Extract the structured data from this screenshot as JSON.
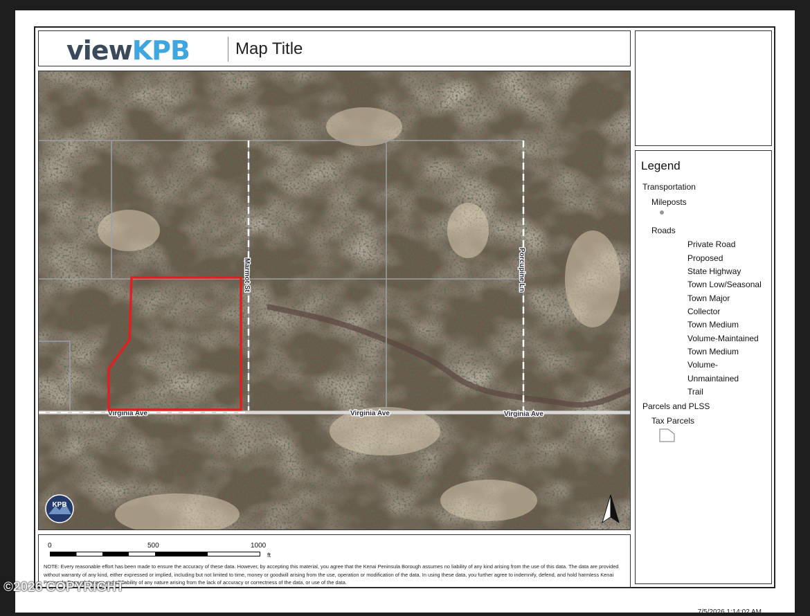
{
  "header": {
    "logo_part1": "view",
    "logo_part2": "KPB",
    "map_title": "Map Title"
  },
  "legend": {
    "title": "Legend",
    "items": [
      "Transportation",
      "Mileposts",
      "Roads",
      "Private Road",
      "Proposed",
      "State Highway",
      "Town Low/Seasonal",
      "Town Major",
      "Collector",
      "Town Medium",
      "Volume-Maintained",
      "Town Medium",
      "Volume-",
      "Unmaintained",
      "Trail",
      "Parcels and PLSS",
      "Tax Parcels"
    ]
  },
  "map": {
    "road_labels": [
      "Virginia Ave",
      "Virginia Ave",
      "Virginia Ave",
      "Marmot St",
      "Porcupine Ln"
    ],
    "badge": "KPB",
    "colors": {
      "parcel_outline": "#e02020",
      "grid_line": "#9aa0a6",
      "road": "#d8d8d8"
    }
  },
  "scale_bar": {
    "labels": [
      "0",
      "500",
      "1000"
    ],
    "unit": "ft"
  },
  "note": "NOTE: Every reasonable effort has been made to ensure the accuracy of these data. However, by accepting this material, you agree that the Kenai Peninsula Borough assumes no liability of any kind arising from the use of this data. The data are provided without warranty of any kind, either expressed or implied, including but not limited to time, money or goodwill arising from the use, operation or modification of the data.  In using these data, you further agree to indemnify, defend, and hold harmless Kenai Peninsula Borough for any and all liability of any nature arising from the lack of accuracy or correctness of the data, or use of the data.",
  "timestamp": "7/5/2026 1:14:02 AM",
  "watermark": "©2026 COPYRIGHT"
}
